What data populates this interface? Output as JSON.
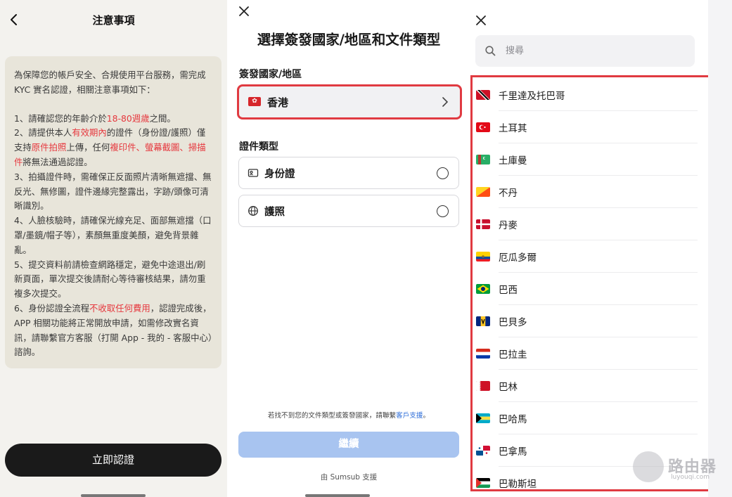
{
  "notice": {
    "title": "注意事項",
    "intro": "為保障您的帳戶安全、合規使用平台服務，需完成 KYC 實名認證，相關注意事項如下：",
    "item1_a": "1、請確認您的年齡介於",
    "item1_red": "18-80週歲",
    "item1_b": "之間。",
    "item2_a": "2、請提供本人",
    "item2_red1": "有效期內",
    "item2_b": "的證件（身份證/護照）僅支持",
    "item2_red2": "原件拍照",
    "item2_c": "上傳，任何",
    "item2_red3": "複印件、螢幕截圖、掃描件",
    "item2_d": "將無法通過認證。",
    "item3": "3、拍攝證件時，需確保正反面照片清晰無遮擋、無反光、無修圖，證件邊緣完整露出，字跡/頭像可清晰識別。",
    "item4": "4、人臉核驗時，請確保光線充足、面部無遮擋（口罩/墨鏡/帽子等），素顏無重度美顏，避免背景雜亂。",
    "item5": "5、提交資料前請檢查網路穩定，避免中途退出/刷新頁面，單次提交後請耐心等待審核結果，請勿重複多次提交。",
    "item6_a": "6、身份認證全流程",
    "item6_red": "不收取任何費用",
    "item6_b": "，認證完成後，APP 相關功能將正常開放申請，如需修改實名資訊，請聯繫官方客服（打開 App - 我的 - 客服中心）諮詢。",
    "cta": "立即認證"
  },
  "select": {
    "title": "選擇簽發國家/地區和文件類型",
    "country_label": "簽發國家/地區",
    "country_value": "香港",
    "doctype_label": "證件類型",
    "docs": [
      {
        "label": "身份證",
        "icon": "id-card-icon"
      },
      {
        "label": "護照",
        "icon": "globe-icon"
      }
    ],
    "help_text": "若找不到您的文件類型或簽發國家，請聯繫",
    "help_link": "客戶支援",
    "help_end": "。",
    "continue": "繼續",
    "powered": "由 Sumsub 支援"
  },
  "countries": {
    "search_placeholder": "搜尋",
    "items": [
      {
        "name": "千里達及托巴哥",
        "flag": "trinidad-flag"
      },
      {
        "name": "土耳其",
        "flag": "turkey-flag"
      },
      {
        "name": "土庫曼",
        "flag": "turkmenistan-flag"
      },
      {
        "name": "不丹",
        "flag": "bhutan-flag"
      },
      {
        "name": "丹麥",
        "flag": "denmark-flag"
      },
      {
        "name": "厄瓜多爾",
        "flag": "ecuador-flag"
      },
      {
        "name": "巴西",
        "flag": "brazil-flag"
      },
      {
        "name": "巴貝多",
        "flag": "barbados-flag"
      },
      {
        "name": "巴拉圭",
        "flag": "paraguay-flag"
      },
      {
        "name": "巴林",
        "flag": "bahrain-flag"
      },
      {
        "name": "巴哈馬",
        "flag": "bahamas-flag"
      },
      {
        "name": "巴拿馬",
        "flag": "panama-flag"
      },
      {
        "name": "巴勒斯坦",
        "flag": "palestine-flag"
      }
    ]
  },
  "watermark": {
    "text": "路由器",
    "sub": "luyouqi.com"
  },
  "colors": {
    "highlight_red": "#e03a41",
    "notice_red": "#e6383e",
    "link_blue": "#2b6cd9",
    "button_dark": "#1a1a1a",
    "continue_disabled": "#a8c4f0"
  }
}
